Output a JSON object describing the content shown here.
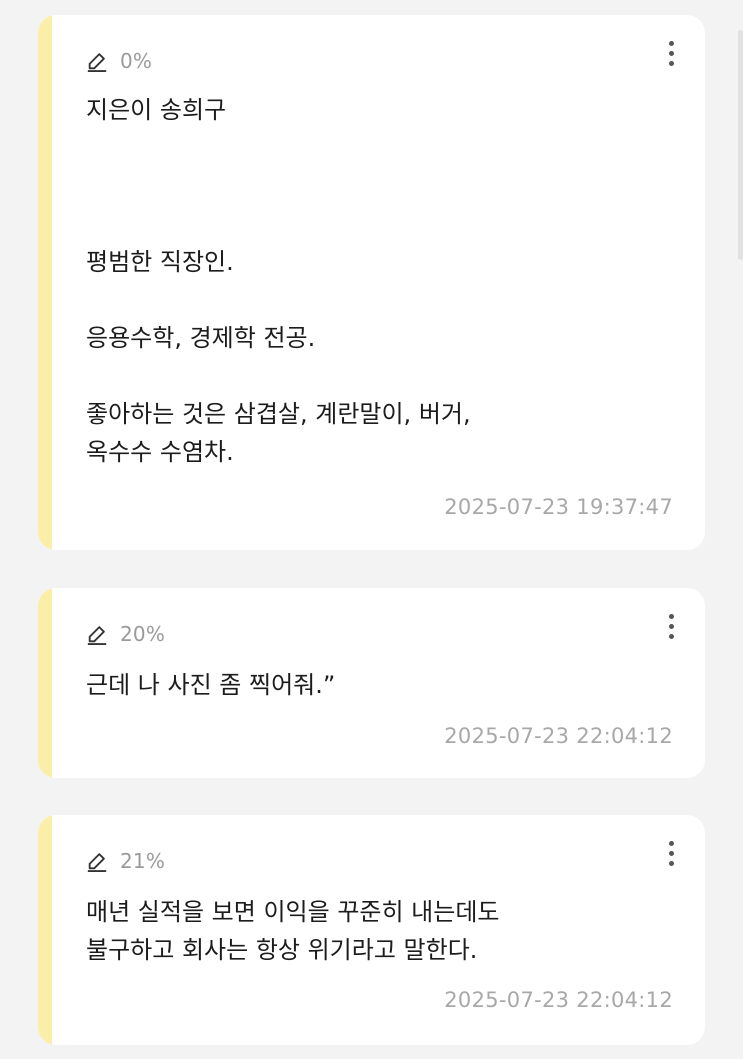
{
  "theme": {
    "background": "#f3f3f3",
    "card_background": "#ffffff",
    "accent_stripe": "#fbeea8",
    "meta_text": "#9a9a9a",
    "body_text": "#1c1c1c",
    "timestamp_text": "#a8a8a8"
  },
  "cards": [
    {
      "progress": "0%",
      "icon": "pencil-icon",
      "menu_icon": "more-vertical-icon",
      "lines": [
        "지은이 송희구",
        "",
        "",
        "",
        "평범한 직장인.",
        "",
        "응용수학, 경제학 전공.",
        "",
        "좋아하는 것은 삼겹살, 계란말이, 버거,",
        "옥수수 수염차."
      ],
      "timestamp": "2025-07-23 19:37:47"
    },
    {
      "progress": "20%",
      "icon": "pencil-icon",
      "menu_icon": "more-vertical-icon",
      "lines": [
        "근데 나 사진 좀 찍어줘.”"
      ],
      "timestamp": "2025-07-23 22:04:12"
    },
    {
      "progress": "21%",
      "icon": "pencil-icon",
      "menu_icon": "more-vertical-icon",
      "lines": [
        "매년 실적을 보면 이익을 꾸준히 내는데도",
        "불구하고 회사는 항상 위기라고 말한다."
      ],
      "timestamp": "2025-07-23 22:04:12"
    }
  ]
}
